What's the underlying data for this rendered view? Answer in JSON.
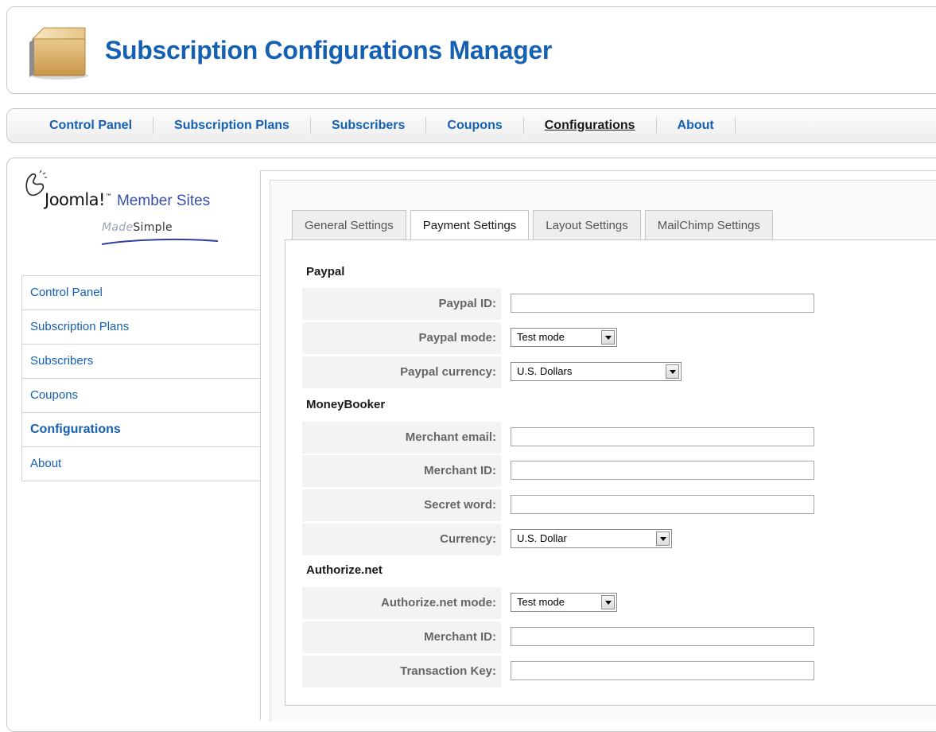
{
  "header": {
    "title": "Subscription Configurations Manager",
    "icon": "package-box-icon"
  },
  "top_menu": [
    {
      "label": "Control Panel",
      "active": false
    },
    {
      "label": "Subscription Plans",
      "active": false
    },
    {
      "label": "Subscribers",
      "active": false
    },
    {
      "label": "Coupons",
      "active": false
    },
    {
      "label": "Configurations",
      "active": true
    },
    {
      "label": "About",
      "active": false
    }
  ],
  "logo": {
    "brand": "Joomla!",
    "tm": "™",
    "product": "Member Sites",
    "made": "Made",
    "simple": "Simple"
  },
  "sidebar": [
    {
      "label": "Control Panel",
      "active": false
    },
    {
      "label": "Subscription Plans",
      "active": false
    },
    {
      "label": "Subscribers",
      "active": false
    },
    {
      "label": "Coupons",
      "active": false
    },
    {
      "label": "Configurations",
      "active": true
    },
    {
      "label": "About",
      "active": false
    }
  ],
  "tabs": [
    {
      "label": "General Settings",
      "active": false
    },
    {
      "label": "Payment Settings",
      "active": true
    },
    {
      "label": "Layout Settings",
      "active": false
    },
    {
      "label": "MailChimp Settings",
      "active": false
    }
  ],
  "sections": {
    "paypal": {
      "title": "Paypal",
      "id_label": "Paypal ID:",
      "id_value": "",
      "mode_label": "Paypal mode:",
      "mode_value": "Test mode",
      "currency_label": "Paypal currency:",
      "currency_value": "U.S. Dollars"
    },
    "moneybooker": {
      "title": "MoneyBooker",
      "email_label": "Merchant email:",
      "email_value": "",
      "merchant_id_label": "Merchant ID:",
      "merchant_id_value": "",
      "secret_label": "Secret word:",
      "secret_value": "",
      "currency_label": "Currency:",
      "currency_value": "U.S. Dollar"
    },
    "authorize": {
      "title": "Authorize.net",
      "mode_label": "Authorize.net mode:",
      "mode_value": "Test mode",
      "merchant_id_label": "Merchant ID:",
      "merchant_id_value": "",
      "key_label": "Transaction Key:",
      "key_value": ""
    }
  },
  "colors": {
    "accent": "#1460b3",
    "label_bg": "#f3f3f3",
    "border": "#c8c8c8"
  }
}
